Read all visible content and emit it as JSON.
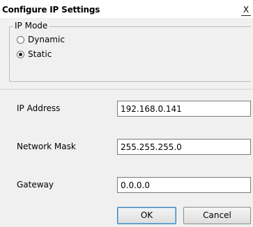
{
  "window": {
    "title": "Configure IP Settings",
    "close_glyph": "X"
  },
  "ip_mode": {
    "legend": "IP Mode",
    "options": [
      {
        "label": "Dynamic",
        "selected": false
      },
      {
        "label": "Static",
        "selected": true
      }
    ]
  },
  "fields": {
    "ip_address": {
      "label": "IP Address",
      "value": "192.168.0.141"
    },
    "network_mask": {
      "label": "Network Mask",
      "value": "255.255.255.0"
    },
    "gateway": {
      "label": "Gateway",
      "value": "0.0.0.0"
    }
  },
  "buttons": {
    "ok_label": "OK",
    "cancel_label": "Cancel"
  }
}
